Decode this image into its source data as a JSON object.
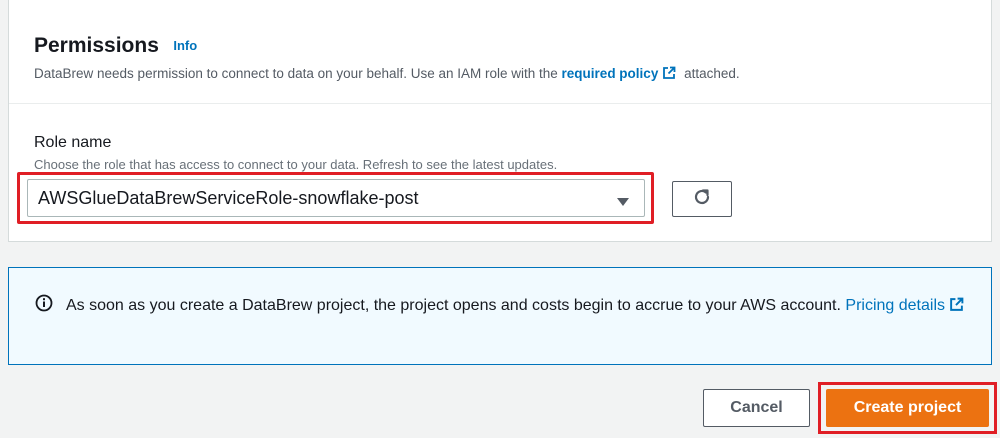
{
  "permissions": {
    "title": "Permissions",
    "info_label": "Info",
    "description_prefix": "DataBrew needs permission to connect to data on your behalf. Use an IAM role with the ",
    "policy_link": "required policy",
    "description_suffix": "attached.",
    "external_icon": "external-link-icon"
  },
  "role": {
    "label": "Role name",
    "hint": "Choose the role that has access to connect to your data. Refresh to see the latest updates.",
    "selected_value": "AWSGlueDataBrewServiceRole-snowflake-post",
    "caret_icon": "caret-down-icon",
    "refresh_icon": "refresh-icon"
  },
  "alert": {
    "icon": "info-circle-icon",
    "text": "As soon as you create a DataBrew project, the project opens and costs begin to accrue to your AWS account. ",
    "link": "Pricing details"
  },
  "actions": {
    "cancel_label": "Cancel",
    "create_label": "Create project"
  },
  "colors": {
    "link": "#0073bb",
    "primary": "#ec7211",
    "highlight": "#e01e25",
    "alert_bg": "#f1faff"
  }
}
